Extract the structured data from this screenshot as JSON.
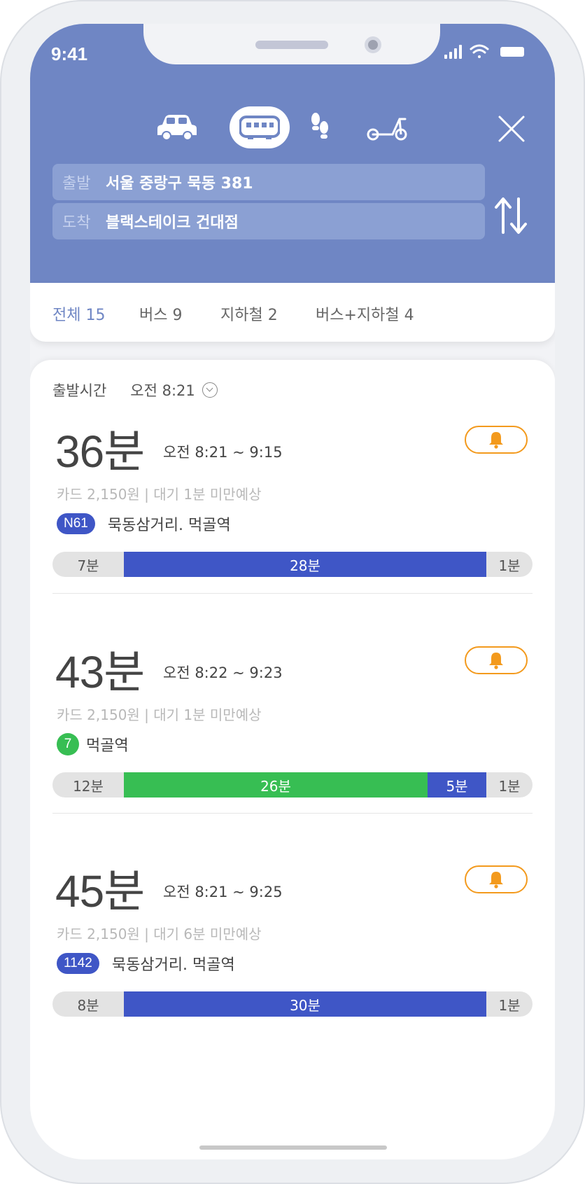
{
  "status": {
    "time": "9:41"
  },
  "modes": [
    {
      "name": "car-icon",
      "selected": false
    },
    {
      "name": "bus-icon",
      "selected": true
    },
    {
      "name": "walk-icon",
      "selected": false
    },
    {
      "name": "scooter-icon",
      "selected": false
    }
  ],
  "search": {
    "origin_label": "출발",
    "origin_value": "서울 중랑구 묵동 381",
    "dest_label": "도착",
    "dest_value": "블랙스테이크 건대점"
  },
  "filters": [
    {
      "label": "전체 15",
      "active": true
    },
    {
      "label": "버스 9",
      "active": false
    },
    {
      "label": "지하철 2",
      "active": false
    },
    {
      "label": "버스+지하철 4",
      "active": false
    }
  ],
  "departure": {
    "label": "출발시간",
    "value": "오전 8:21"
  },
  "routes": [
    {
      "duration": "36분",
      "time_range": "오전 8:21 ~ 9:15",
      "fare": "카드 2,150원 | 대기 1분 미만예상",
      "badge_type": "bus",
      "badge": "N61",
      "stations": "묵동삼거리. 먹골역",
      "segments": [
        {
          "type": "walk",
          "label": "7분",
          "minutes": 7
        },
        {
          "type": "bus",
          "label": "28분",
          "minutes": 28
        },
        {
          "type": "walk",
          "label": "1분",
          "minutes": 1
        }
      ]
    },
    {
      "duration": "43분",
      "time_range": "오전 8:22 ~ 9:23",
      "fare": "카드 2,150원 | 대기 1분 미만예상",
      "badge_type": "subway",
      "badge": "7",
      "stations": "먹골역",
      "segments": [
        {
          "type": "walk",
          "label": "12분",
          "minutes": 12
        },
        {
          "type": "subway",
          "label": "26분",
          "minutes": 26
        },
        {
          "type": "bus",
          "label": "5분",
          "minutes": 5
        },
        {
          "type": "walk",
          "label": "1분",
          "minutes": 1
        }
      ]
    },
    {
      "duration": "45분",
      "time_range": "오전 8:21 ~ 9:25",
      "fare": "카드 2,150원 | 대기 6분 미만예상",
      "badge_type": "bus",
      "badge": "1142",
      "stations": "묵동삼거리. 먹골역",
      "segments": [
        {
          "type": "walk",
          "label": "8분",
          "minutes": 8
        },
        {
          "type": "bus",
          "label": "30분",
          "minutes": 30
        },
        {
          "type": "walk",
          "label": "1분",
          "minutes": 1
        }
      ]
    }
  ],
  "colors": {
    "header": "#6f86c4",
    "bus": "#3f56c6",
    "subway_line7": "#37be53",
    "alarm": "#f39a1d"
  }
}
